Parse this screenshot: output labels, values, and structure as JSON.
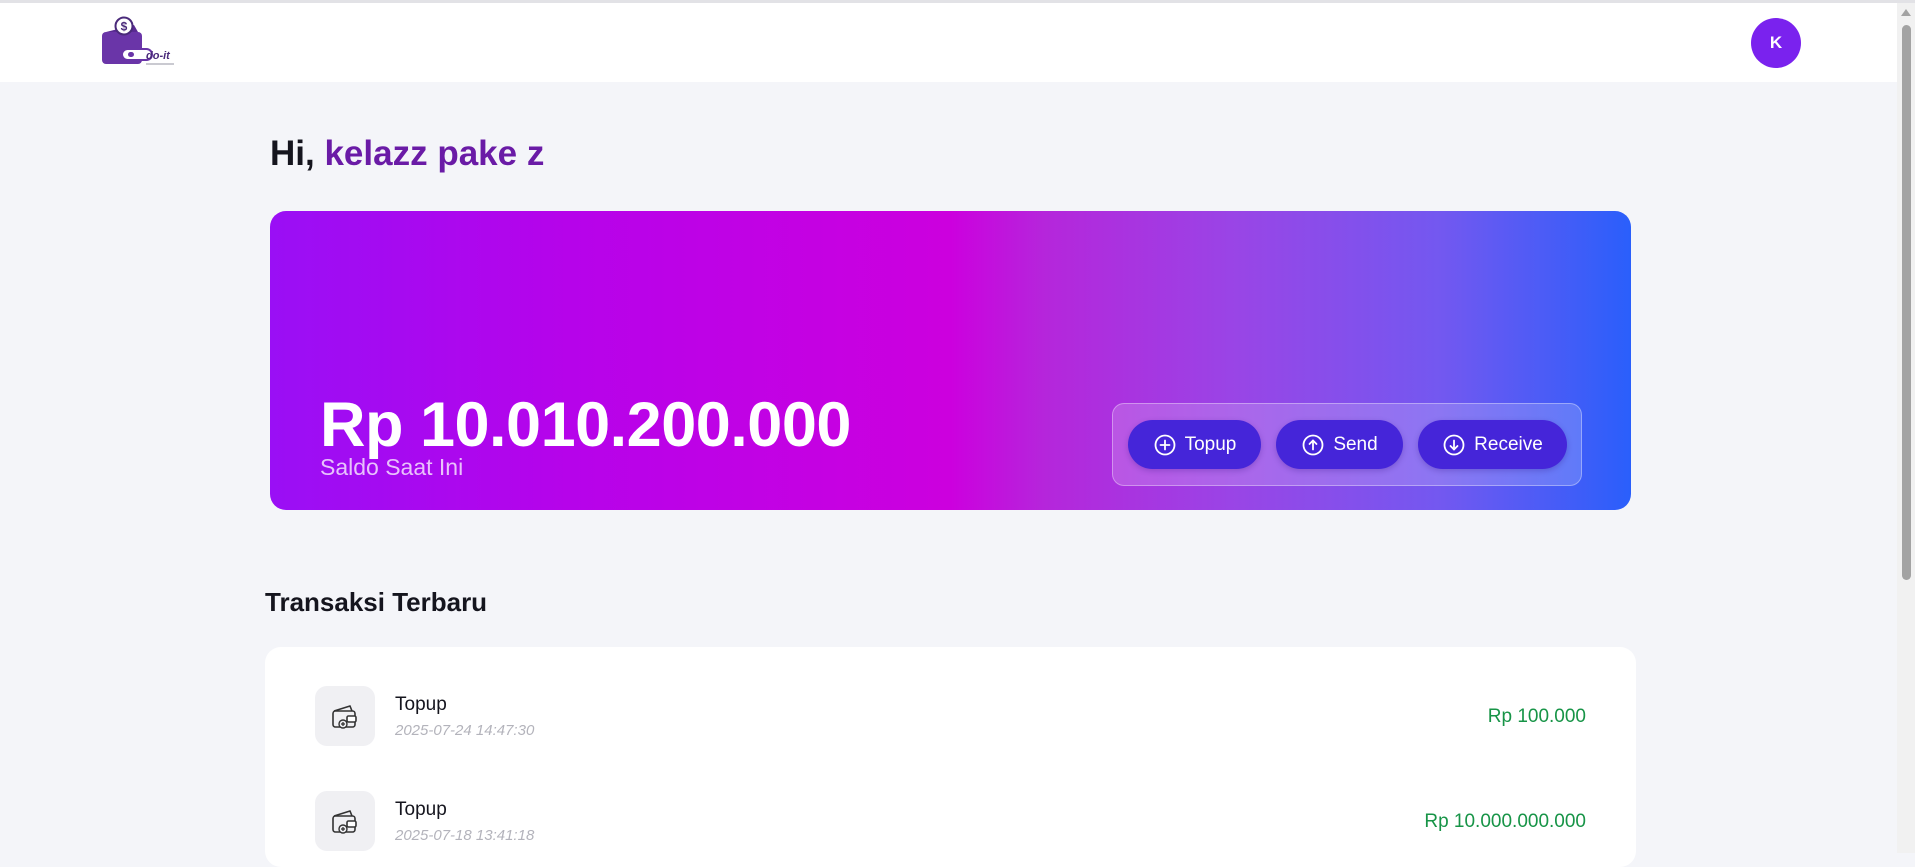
{
  "header": {
    "logo_text": "do-it",
    "avatar_initial": "K"
  },
  "greeting": {
    "prefix": "Hi,",
    "username": "kelazz pake z"
  },
  "balance": {
    "amount": "Rp 10.010.200.000",
    "label": "Saldo Saat Ini",
    "actions": [
      {
        "label": "Topup",
        "icon": "plus-circle-icon"
      },
      {
        "label": "Send",
        "icon": "arrow-up-circle-icon"
      },
      {
        "label": "Receive",
        "icon": "arrow-down-circle-icon"
      }
    ]
  },
  "transactions": {
    "title": "Transaksi Terbaru",
    "items": [
      {
        "type": "Topup",
        "date": "2025-07-24 14:47:30",
        "amount": "Rp 100.000",
        "icon": "wallet-icon"
      },
      {
        "type": "Topup",
        "date": "2025-07-18 13:41:18",
        "amount": "Rp 10.000.000.000",
        "icon": "wallet-icon"
      }
    ]
  },
  "colors": {
    "brand_purple": "#7a22ee",
    "username_purple": "#6a1ba6",
    "action_button": "#4525d9",
    "positive_amount": "#179447",
    "card_gradient": [
      "#9a0ff5",
      "#cc00de",
      "#2a5ffb"
    ]
  }
}
